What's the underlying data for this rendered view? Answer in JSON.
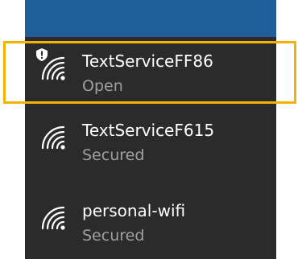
{
  "networks": [
    {
      "name": "TextServiceFF86",
      "status": "Open",
      "icon": "wifi-warning-icon"
    },
    {
      "name": "TextServiceF615",
      "status": "Secured",
      "icon": "wifi-icon"
    },
    {
      "name": "personal-wifi",
      "status": "Secured",
      "icon": "wifi-icon"
    }
  ],
  "colors": {
    "panel_bg": "#2b2b2b",
    "top_strip": "#1f5e99",
    "highlight": "#f2b400",
    "name_text": "#ffffff",
    "status_text": "#a0a0a0"
  }
}
